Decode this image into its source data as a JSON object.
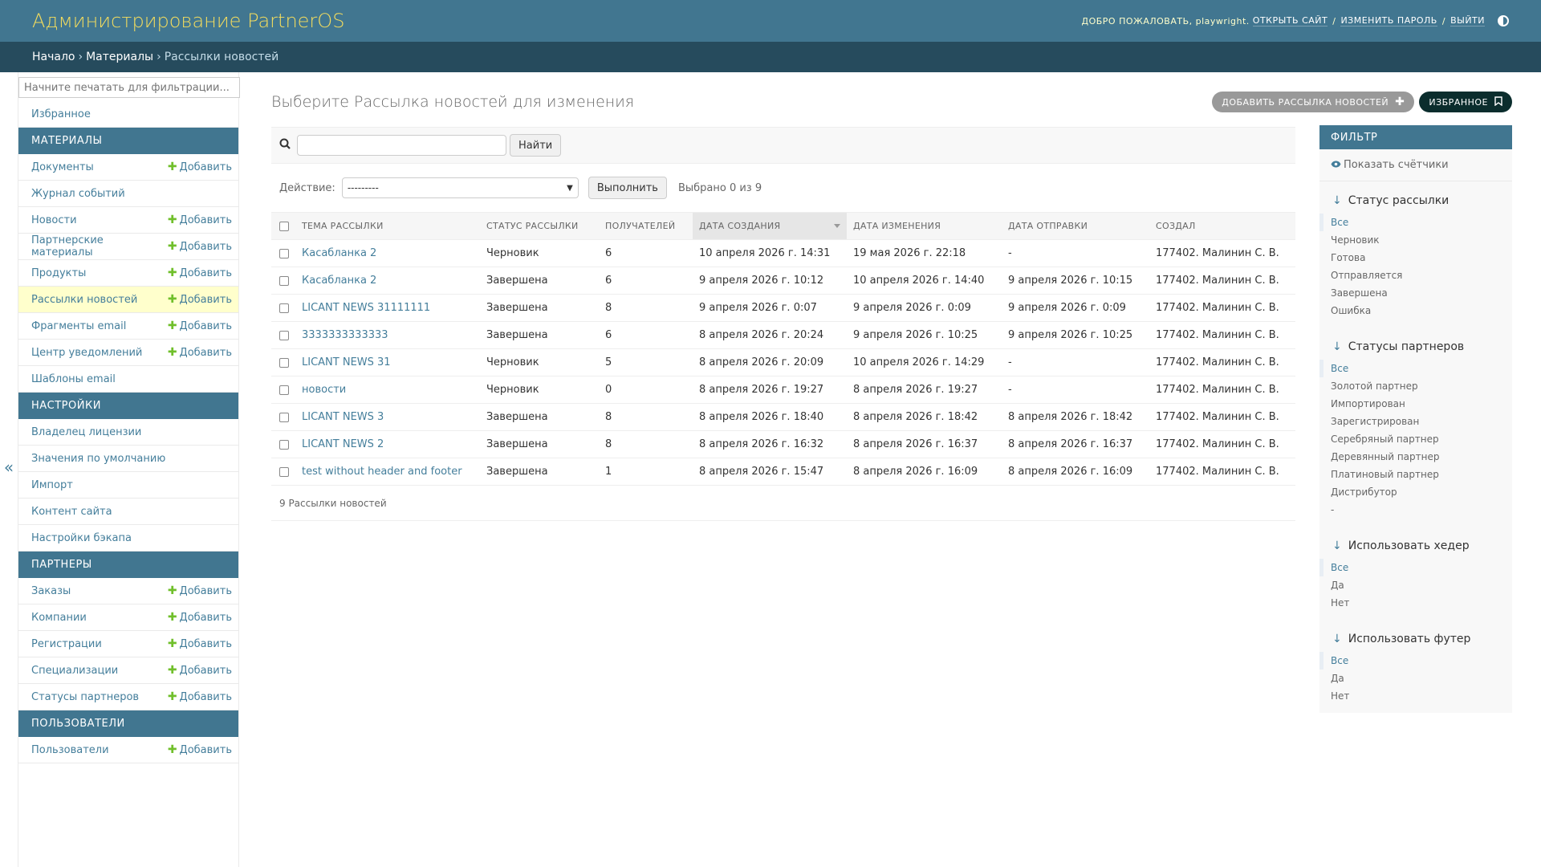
{
  "header": {
    "branding": "Администрирование PartnerOS",
    "welcome": "Добро пожаловать,",
    "username": "playwright.",
    "links": [
      "Открыть сайт",
      "Изменить пароль",
      "Выйти"
    ]
  },
  "breadcrumbs": [
    "Начало",
    "Материалы",
    "Рассылки новостей"
  ],
  "sidebar": {
    "filter_placeholder": "Начните печатать для фильтрации...",
    "favorites": "Избранное",
    "add_label": "Добавить",
    "sections": [
      {
        "title": "Материалы",
        "items": [
          {
            "label": "Документы",
            "add": true
          },
          {
            "label": "Журнал событий",
            "add": false
          },
          {
            "label": "Новости",
            "add": true
          },
          {
            "label": "Партнерские материалы",
            "add": true
          },
          {
            "label": "Продукты",
            "add": true
          },
          {
            "label": "Рассылки новостей",
            "add": true,
            "current": true
          },
          {
            "label": "Фрагменты email",
            "add": true
          },
          {
            "label": "Центр уведомлений",
            "add": true
          },
          {
            "label": "Шаблоны email",
            "add": false
          }
        ]
      },
      {
        "title": "Настройки",
        "items": [
          {
            "label": "Владелец лицензии",
            "add": false
          },
          {
            "label": "Значения по умолчанию",
            "add": false
          },
          {
            "label": "Импорт",
            "add": false
          },
          {
            "label": "Контент сайта",
            "add": false
          },
          {
            "label": "Настройки бэкапа",
            "add": false
          }
        ]
      },
      {
        "title": "Партнеры",
        "items": [
          {
            "label": "Заказы",
            "add": true
          },
          {
            "label": "Компании",
            "add": true
          },
          {
            "label": "Регистрации",
            "add": true
          },
          {
            "label": "Специализации",
            "add": true
          },
          {
            "label": "Статусы партнеров",
            "add": true
          }
        ]
      },
      {
        "title": "Пользователи",
        "items": [
          {
            "label": "Пользователи",
            "add": true
          }
        ]
      }
    ],
    "collapse_icon": "«"
  },
  "main": {
    "title": "Выберите Рассылка новостей для изменения",
    "add_button": "Добавить Рассылка новостей",
    "favorites_button": "Избранное",
    "search_button": "Найти",
    "action_label": "Действие:",
    "action_selected": "---------",
    "run_button": "Выполнить",
    "selected_counter": "Выбрано 0 из 9",
    "columns": [
      "Тема рассылки",
      "Статус рассылки",
      "Получателей",
      "Дата создания",
      "Дата изменения",
      "Дата отправки",
      "Создал"
    ],
    "rows": [
      [
        "Касабланка 2",
        "Черновик",
        "6",
        "10 апреля 2026 г. 14:31",
        "19 мая 2026 г. 22:18",
        "-",
        "177402. Малинин С. В."
      ],
      [
        "Касабланка 2",
        "Завершена",
        "6",
        "9 апреля 2026 г. 10:12",
        "10 апреля 2026 г. 14:40",
        "9 апреля 2026 г. 10:15",
        "177402. Малинин С. В."
      ],
      [
        "LICANT NEWS 31111111",
        "Завершена",
        "8",
        "9 апреля 2026 г. 0:07",
        "9 апреля 2026 г. 0:09",
        "9 апреля 2026 г. 0:09",
        "177402. Малинин С. В."
      ],
      [
        "3333333333333",
        "Завершена",
        "6",
        "8 апреля 2026 г. 20:24",
        "9 апреля 2026 г. 10:25",
        "9 апреля 2026 г. 10:25",
        "177402. Малинин С. В."
      ],
      [
        "LICANT NEWS 31",
        "Черновик",
        "5",
        "8 апреля 2026 г. 20:09",
        "10 апреля 2026 г. 14:29",
        "-",
        "177402. Малинин С. В."
      ],
      [
        "новости",
        "Черновик",
        "0",
        "8 апреля 2026 г. 19:27",
        "8 апреля 2026 г. 19:27",
        "-",
        "177402. Малинин С. В."
      ],
      [
        "LICANT NEWS 3",
        "Завершена",
        "8",
        "8 апреля 2026 г. 18:40",
        "8 апреля 2026 г. 18:42",
        "8 апреля 2026 г. 18:42",
        "177402. Малинин С. В."
      ],
      [
        "LICANT NEWS 2",
        "Завершена",
        "8",
        "8 апреля 2026 г. 16:32",
        "8 апреля 2026 г. 16:37",
        "8 апреля 2026 г. 16:37",
        "177402. Малинин С. В."
      ],
      [
        "test without header and footer",
        "Завершена",
        "1",
        "8 апреля 2026 г. 15:47",
        "8 апреля 2026 г. 16:09",
        "8 апреля 2026 г. 16:09",
        "177402. Малинин С. В."
      ]
    ],
    "paginator": "9 Рассылки новостей"
  },
  "filter": {
    "title": "Фильтр",
    "show_counts": "Показать счётчики",
    "groups": [
      {
        "title": "Статус рассылки",
        "options": [
          "Все",
          "Черновик",
          "Готова",
          "Отправляется",
          "Завершена",
          "Ошибка"
        ]
      },
      {
        "title": "Статусы партнеров",
        "options": [
          "Все",
          "Золотой партнер",
          "Импортирован",
          "Зарегистрирован",
          "Серебряный партнер",
          "Деревянный партнер",
          "Платиновый партнер",
          "Дистрибутор",
          "-"
        ]
      },
      {
        "title": "Использовать хедер",
        "options": [
          "Все",
          "Да",
          "Нет"
        ]
      },
      {
        "title": "Использовать футер",
        "options": [
          "Все",
          "Да",
          "Нет"
        ]
      }
    ]
  },
  "colors": {
    "header_bg": "#417690",
    "breadcrumbs_bg": "#264b5d",
    "branding": "#f5dd5d",
    "link": "#447e9b",
    "add_plus": "#70bf2b",
    "current_row": "#ffffcc"
  }
}
